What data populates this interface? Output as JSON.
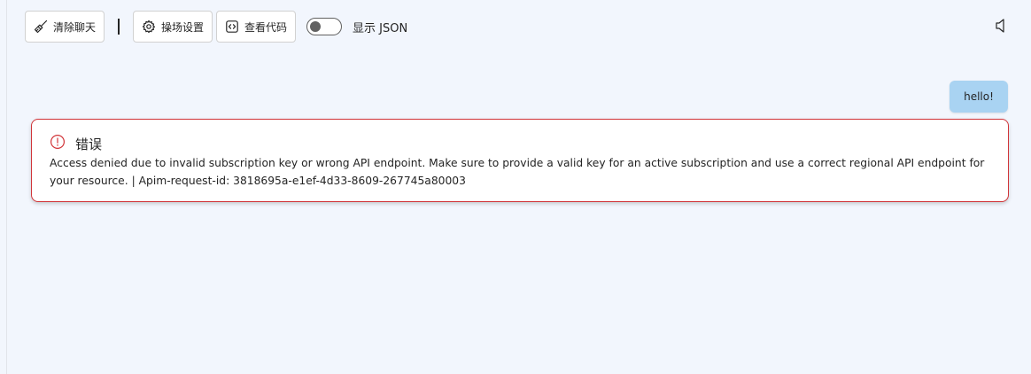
{
  "toolbar": {
    "clear_chat_label": "清除聊天",
    "playground_settings_label": "操场设置",
    "view_code_label": "查看代码",
    "show_json_label": "显示 JSON",
    "show_json_on": false
  },
  "chat": {
    "user_message": "hello!",
    "error": {
      "title": "错误",
      "message": "Access denied due to invalid subscription key or wrong API endpoint. Make sure to provide a valid key for an active subscription and use a correct regional API endpoint for your resource. | Apim-request-id: 3818695a-e1ef-4d33-8609-267745a80003"
    }
  },
  "colors": {
    "background": "#f2f6fd",
    "user_bubble": "#a9d3f2",
    "error_border": "#d13438"
  },
  "icons": {
    "clear_chat": "broom-icon",
    "settings": "gear-icon",
    "view_code": "code-icon",
    "error": "info-circle-icon",
    "audio": "speaker-icon"
  }
}
